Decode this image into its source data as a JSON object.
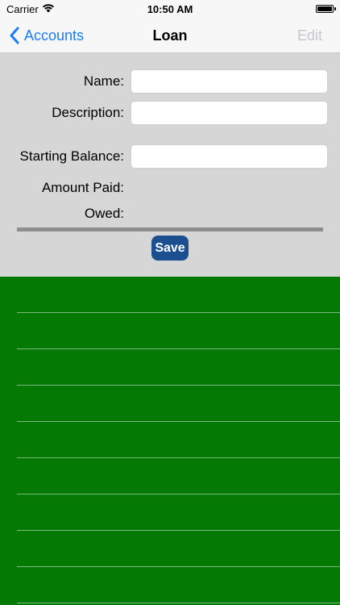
{
  "status_bar": {
    "carrier": "Carrier",
    "time": "10:50 AM",
    "wifi_icon": "wifi-icon",
    "battery_icon": "battery-icon"
  },
  "nav": {
    "back_label": "Accounts",
    "title": "Loan",
    "edit_label": "Edit",
    "accent_color": "#1a7cf6"
  },
  "form": {
    "name_label": "Name:",
    "name_value": "",
    "description_label": "Description:",
    "description_value": "",
    "starting_balance_label": "Starting Balance:",
    "starting_balance_value": "",
    "amount_paid_label": "Amount Paid:",
    "owed_label": "Owed:",
    "save_label": "Save"
  },
  "list": {
    "background_color": "#047a05",
    "row_count": 8
  }
}
